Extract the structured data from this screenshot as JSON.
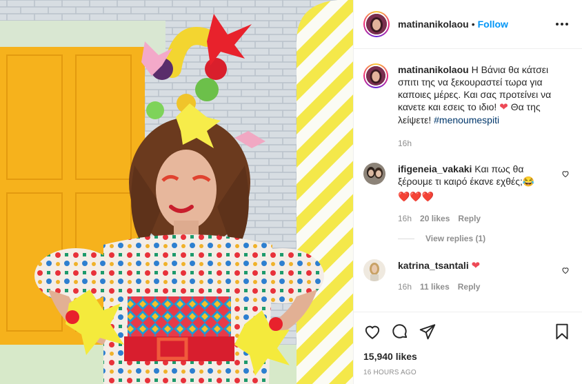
{
  "post": {
    "author": "matinanikolaou",
    "follow_label": "Follow",
    "separator": "•",
    "caption": "Η Βάνια θα κάτσει σπιτι της να ξεκουραστεί τωρα για καποιες μέρες. Και σας προτείνει να κανετε και εσεις το ιδιο!",
    "caption_heart": "❤",
    "caption_tail": "Θα της λείψετε!",
    "hashtag": "#menoumespiti",
    "caption_age": "16h"
  },
  "comments": [
    {
      "user": "ifigeneia_vakaki",
      "text": "Και πως θα ξέρουμε τι καιρό έκανε εχθές;😂",
      "hearts": "❤️❤️❤️",
      "age": "16h",
      "likes": "20 likes",
      "reply": "Reply",
      "view_replies": "View replies (1)"
    },
    {
      "user": "katrina_tsantali",
      "text": "❤",
      "age": "16h",
      "likes": "11 likes",
      "reply": "Reply"
    }
  ],
  "stats": {
    "likes": "15,940 likes",
    "time": "16 HOURS AGO"
  },
  "icons": {
    "like": "heart-outline-icon",
    "comment": "speech-bubble-icon",
    "share": "paper-plane-icon",
    "save": "bookmark-icon",
    "more": "more-dots-icon"
  },
  "colors": {
    "follow": "#0095f6",
    "heart": "#ed4956",
    "muted": "#8e8e8e",
    "hashtag": "#00376b"
  }
}
